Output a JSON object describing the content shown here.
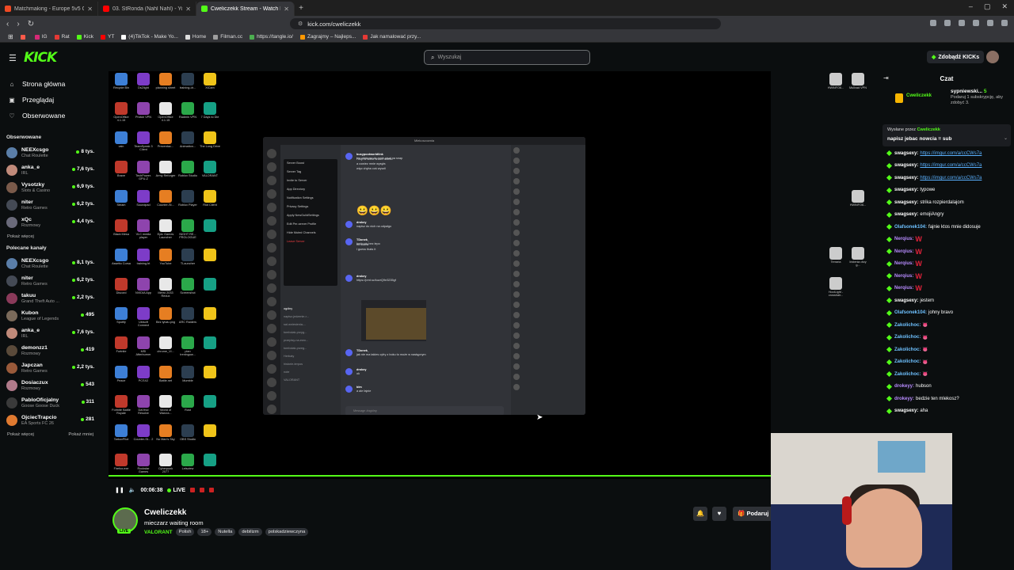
{
  "browser": {
    "tabs": [
      {
        "label": "Matchmaking - Europe 5v5 Queue -",
        "color": "#f04a24",
        "active": false
      },
      {
        "label": "03. StRonda (Nahl Nahl) - YouTube",
        "color": "#ff0000",
        "active": false
      },
      {
        "label": "Cweliczekk Stream - Watch L",
        "color": "#53fc18",
        "active": true
      }
    ],
    "new_tab": "+",
    "url": "kick.com/cweliczekk",
    "bookmarks": [
      {
        "label": "",
        "color": "#ff5a4a"
      },
      {
        "label": "IG",
        "color": "#d62976"
      },
      {
        "label": "Rat",
        "color": "#e53935"
      },
      {
        "label": "Kick",
        "color": "#53fc18"
      },
      {
        "label": "YT",
        "color": "#ff0000"
      },
      {
        "label": "(4)TikTok - Make Yo...",
        "color": "#ffffff"
      },
      {
        "label": "Home",
        "color": "#dddddd"
      },
      {
        "label": "Filman.cc",
        "color": "#9e9e9e"
      },
      {
        "label": "https://tangle.io/",
        "color": "#4caf50"
      },
      {
        "label": "Zagrajmy – Najleps...",
        "color": "#ff9800"
      },
      {
        "label": "Jak namalować przy...",
        "color": "#e53935"
      }
    ]
  },
  "header": {
    "logo": "KICK",
    "search_placeholder": "Wyszukaj",
    "get_kicks": "Zdobądź KICKs"
  },
  "sidebar": {
    "nav": [
      {
        "label": "Strona główna",
        "icon": "home-icon",
        "glyph": "⌂"
      },
      {
        "label": "Przeglądaj",
        "icon": "browse-icon",
        "glyph": "▣"
      },
      {
        "label": "Obserwowane",
        "icon": "heart-icon",
        "glyph": "♡"
      }
    ],
    "followed_title": "Obserwowane",
    "followed": [
      {
        "name": "NEEXcsgo",
        "category": "Chat Roulette",
        "viewers": "8 tys.",
        "color": "#5a7ea8"
      },
      {
        "name": "anka_e",
        "category": "IRL",
        "viewers": "7,6 tys.",
        "color": "#c08a7a"
      },
      {
        "name": "Vysotzky",
        "category": "Slots & Casino",
        "viewers": "6,9 tys.",
        "color": "#7a5a4a"
      },
      {
        "name": "niter",
        "category": "Retro Games",
        "viewers": "6,2 tys.",
        "color": "#444a55"
      },
      {
        "name": "xQc",
        "category": "Rozmowy",
        "viewers": "4,4 tys.",
        "color": "#6a6a7a"
      }
    ],
    "show_more": "Pokaż więcej",
    "recommended_title": "Polecane kanały",
    "recommended": [
      {
        "name": "NEEXcsgo",
        "category": "Chat Roulette",
        "viewers": "8,1 tys.",
        "color": "#5a7ea8"
      },
      {
        "name": "niter",
        "category": "Retro Games",
        "viewers": "6,2 tys.",
        "color": "#444a55"
      },
      {
        "name": "takuu",
        "category": "Grand Theft Auto ...",
        "viewers": "2,2 tys.",
        "color": "#8a3a5a"
      },
      {
        "name": "Kubon",
        "category": "League of Legends",
        "viewers": "495",
        "color": "#7a6a5a"
      },
      {
        "name": "anka_e",
        "category": "IRL",
        "viewers": "7,6 tys.",
        "color": "#c08a7a"
      },
      {
        "name": "demonzz1",
        "category": "Rozmowy",
        "viewers": "419",
        "color": "#5a4a3a"
      },
      {
        "name": "Japczan",
        "category": "Retro Games",
        "viewers": "2,2 tys.",
        "color": "#9a5a3a"
      },
      {
        "name": "Dosiaczux",
        "category": "Rozmowy",
        "viewers": "543",
        "color": "#b07a8a"
      },
      {
        "name": "PabloOficjalny",
        "category": "Goose Goose Duck",
        "viewers": "311",
        "color": "#3a3a3a"
      },
      {
        "name": "OjciecTrapcio",
        "category": "EA Sports FC 26",
        "viewers": "281",
        "color": "#e07a30"
      }
    ],
    "show_more_2": "Pokaż więcej",
    "show_less": "Pokaż mniej"
  },
  "stream_content": {
    "discord_title": "Mlekoszownia",
    "context_menu": [
      "Server Boost",
      "Server Tag",
      "Invite to Server",
      "App Directory",
      "Notification Settings",
      "Privacy Settings",
      "Apply NewGuildSettings",
      "Edit Per-server Profile",
      "Hide Muted Channels",
      "Leave Server"
    ],
    "channels": [
      "ogólny",
      "napisz-jedzenie-r...",
      "sal-wniesienia-...",
      "tombolak-przyg...",
      "przepisy-na-ewo...",
      "tombolak-przeg...",
      "Herbaty",
      "historie-terpos",
      "note",
      "VALORANT"
    ],
    "messages": [
      {
        "user": "busypootworldlink",
        "text": "ten mlekosz do mnie pisał na snap"
      },
      {
        "user": "",
        "text": "i usył w sobie snach mordo"
      },
      {
        "user": "",
        "text": "a cowiez mnie wysyła"
      },
      {
        "user": "",
        "text": "więc chyba coś wyszli"
      },
      {
        "user": "drokey",
        "text": "napisz do nich na odpalgo"
      },
      {
        "user": "TDonek_",
        "text": "bedo pic bez lepo"
      },
      {
        "user": "",
        "text": "no dobra"
      },
      {
        "user": "",
        "text": "i guess thats it"
      },
      {
        "user": "drokey",
        "text": "https://prnt.sc/kuzrQ9e3235gf"
      },
      {
        "user": "TDonek_",
        "text": "jak nie ma takies cyfry z boku to może w następnym"
      },
      {
        "user": "drokey",
        "text": "ok"
      },
      {
        "user": "blm",
        "text": "a ale fajnie"
      }
    ],
    "emojis": "😀😀😀",
    "input_placeholder": "Message #ogólny",
    "desktop_icons_left": [
      "Recycle Bin",
      "Ds2light",
      "planning sheet",
      "training-dr...",
      "XiCam",
      "OpenOffice 4.1.15",
      "Proton VPN",
      "OpenOffice 4.1.15",
      "Radmin VPN",
      "7 Days to Die",
      "vsin",
      "TeamSpeak 3 Client",
      "Prezentac...",
      "Animation...",
      "The Long Drive",
      "Brave",
      "TechPower. GPU-Z",
      "Army Reforger",
      "Roblox Studio",
      "VALORANT",
      "Steam",
      "Soundpad",
      "Counter-St...",
      "Roblox Player",
      "Riot Client",
      "Black Mesa",
      "VLC media player",
      "Epic Games Launcher",
      "NIGHT RE... PROLOGUE",
      "",
      "Assetto Corsa",
      "training.bt",
      "YouTube",
      "TLauncher",
      "",
      "Discord",
      "NVIDIA App",
      "Metro 2033 Redux",
      "Screenshot",
      "",
      "Spotify",
      "Ubisoft Connect",
      "Bez tytułu.png",
      "ARC Raiders",
      "",
      "Fortnite",
      "MSI Afterburner",
      "chrome_Vi...",
      "plan treningow...",
      "",
      "Peace",
      "PCSX2",
      "Battle.net",
      "Mumble",
      "",
      "Fortnite Battle Royale",
      "DaVinci Resolve",
      "World of Warcra...",
      "Rust",
      "",
      "TarkovPilot",
      "Counter-St... 2",
      "No Man's Sky",
      "OBS Studio",
      "",
      "Firefox.exe",
      "Rockstar Games",
      "Cyberpunk 2077",
      "Letsview",
      ""
    ],
    "desktop_icons_right": [
      "HWiNFO6...",
      "Mullvad VPN",
      "HWiNFO6...",
      "Terraria",
      "Iezienia drzy g...",
      "HoolLight - crosshair..."
    ]
  },
  "player": {
    "time": "00:06:38",
    "live": "LIVE"
  },
  "channel": {
    "name": "Cweliczekk",
    "title": "mieczarz waiting room",
    "category": "VALORANT",
    "tags": [
      "Polish",
      "18+",
      "Nutella",
      "debilizm",
      "polskadziewczyna"
    ],
    "live_badge": "LIVE",
    "gift_label": "Podaruj"
  },
  "chat": {
    "title": "Czat",
    "top_supporter": {
      "name": "Cweliczekk",
      "gifter": "sypniewski...",
      "gifter_count": "5",
      "gifter_text": "Podaruj 1 subskrypcję, aby zdobyć 3."
    },
    "pinned": {
      "by_label": "Wysłane przez",
      "by_user": "Cweliczekk",
      "text": "napisz jebac nowcia = sub"
    },
    "messages": [
      {
        "user": "swagsexy:",
        "text": "https://imgur.com/a/ccCWs7a",
        "type": "link",
        "color": "#ffffff"
      },
      {
        "user": "swagsexy:",
        "text": "https://imgur.com/a/ccCWs7a",
        "type": "link",
        "color": "#ffffff"
      },
      {
        "user": "swagsexy:",
        "text": "https://imgur.com/a/ccCWs7a",
        "type": "link",
        "color": "#ffffff"
      },
      {
        "user": "swagsexy:",
        "text": "typowe",
        "type": "text",
        "color": "#ffffff"
      },
      {
        "user": "swagsexy:",
        "text": "strika rozpierdalajom",
        "type": "text",
        "color": "#ffffff"
      },
      {
        "user": "swagsexy:",
        "text": "emojiAngry",
        "type": "text",
        "color": "#ffffff"
      },
      {
        "user": "Olafsonek104:",
        "text": "fajnie ktos mnie didosuje",
        "type": "text",
        "color": "#6ec1ff"
      },
      {
        "user": "Nerqius:",
        "text": "W",
        "type": "w",
        "color": "#b88cff"
      },
      {
        "user": "Nerqius:",
        "text": "W",
        "type": "w",
        "color": "#b88cff"
      },
      {
        "user": "Nerqius:",
        "text": "W",
        "type": "w",
        "color": "#b88cff"
      },
      {
        "user": "Nerqius:",
        "text": "W",
        "type": "w",
        "color": "#b88cff"
      },
      {
        "user": "Nerqius:",
        "text": "W",
        "type": "w",
        "color": "#b88cff"
      },
      {
        "user": "swagsexy:",
        "text": "jestem",
        "type": "text",
        "color": "#ffffff"
      },
      {
        "user": "Olafsonek104:",
        "text": "johny bravo",
        "type": "text",
        "color": "#6ec1ff"
      },
      {
        "user": "Zakolichoc:",
        "text": "👅",
        "type": "kiss",
        "color": "#6ec1ff"
      },
      {
        "user": "Zakolichoc:",
        "text": "👅",
        "type": "kiss",
        "color": "#6ec1ff"
      },
      {
        "user": "Zakolichoc:",
        "text": "👅",
        "type": "kiss",
        "color": "#6ec1ff"
      },
      {
        "user": "Zakolichoc:",
        "text": "👅",
        "type": "kiss",
        "color": "#6ec1ff"
      },
      {
        "user": "Zakolichoc:",
        "text": "👅",
        "type": "kiss",
        "color": "#6ec1ff"
      },
      {
        "user": "drokeyy:",
        "text": "hubson",
        "type": "text",
        "color": "#b88cff"
      },
      {
        "user": "drokeyy:",
        "text": "bedzie ten mlekosz?",
        "type": "text",
        "color": "#b88cff"
      },
      {
        "user": "swagsexy:",
        "text": "aha",
        "type": "text",
        "color": "#ffffff"
      }
    ]
  },
  "colors": {
    "brand": "#53fc18",
    "bg": "#0b0e0f"
  }
}
